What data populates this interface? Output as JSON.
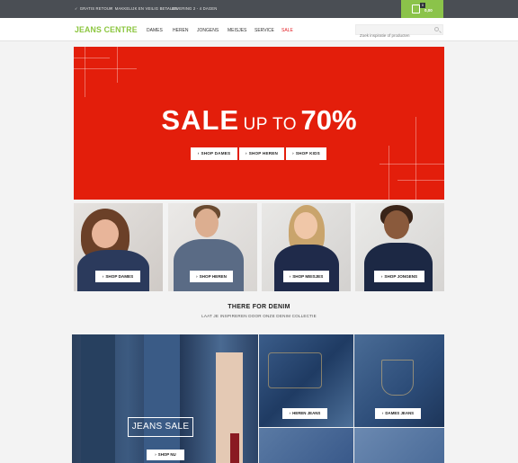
{
  "topbar": {
    "usps": [
      "GRATIS RETOUR",
      "MAKKELIJK EN VEILIG BETALEN",
      "LEVERING 2 - 4 DAGEN"
    ],
    "cart": {
      "count": "0",
      "total": "0,00"
    }
  },
  "header": {
    "logo": "JEANS CENTRE",
    "nav": [
      "DAMES",
      "HEREN",
      "JONGENS",
      "MEISJES",
      "SERVICE",
      "SALE"
    ],
    "search_placeholder": "Zoek inspiratie of producten"
  },
  "hero": {
    "title_sale": "SALE",
    "title_upto": "UP TO",
    "title_pct": "70%",
    "buttons": [
      "SHOP DAMES",
      "SHOP HEREN",
      "SHOP KIDS"
    ]
  },
  "categories": [
    "SHOP DAMES",
    "SHOP HEREN",
    "SHOP MEISJES",
    "SHOP JONGENS"
  ],
  "denim": {
    "title": "THERE FOR DENIM",
    "subtitle": "LAAT JE INSPIREREN DOOR ONZE DENIM COLLECTIE",
    "jeans_sale": "JEANS SALE",
    "shop_now": "SHOP NU",
    "heren_jeans": "HEREN JEANS",
    "dames_jeans": "DAMES JEANS"
  },
  "colors": {
    "topbar": "#4a4e54",
    "brand_green": "#8cc63f",
    "hero_red": "#e31e0b",
    "sale_red": "#e31e24"
  },
  "icons": [
    "check-icon",
    "shopping-bag-icon",
    "search-icon",
    "chevron-right-icon"
  ]
}
